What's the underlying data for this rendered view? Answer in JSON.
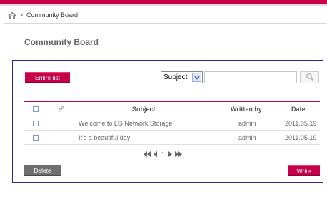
{
  "breadcrumb": {
    "home_icon": "home-icon",
    "current": "Community Board"
  },
  "page": {
    "title": "Community Board"
  },
  "toolbar": {
    "entire_list_label": "Entire list",
    "search_field_selected": "Subject",
    "search_value": "",
    "search_icon": "search-icon"
  },
  "table": {
    "columns": {
      "attachment_icon": "paperclip-icon",
      "subject": "Subject",
      "written_by": "Written by",
      "date": "Date"
    },
    "rows": [
      {
        "subject": "Welcome to LG Network Storage",
        "writer": "admin",
        "date": "2011.05.19"
      },
      {
        "subject": "It's a beautiful day",
        "writer": "admin",
        "date": "2011.05.19"
      }
    ]
  },
  "pagination": {
    "current_page": "1"
  },
  "actions": {
    "delete_label": "Delete",
    "write_label": "Write"
  },
  "colors": {
    "accent": "#c8004a",
    "panel_border": "#2c2a8a",
    "secondary_button": "#6f6f6f"
  }
}
